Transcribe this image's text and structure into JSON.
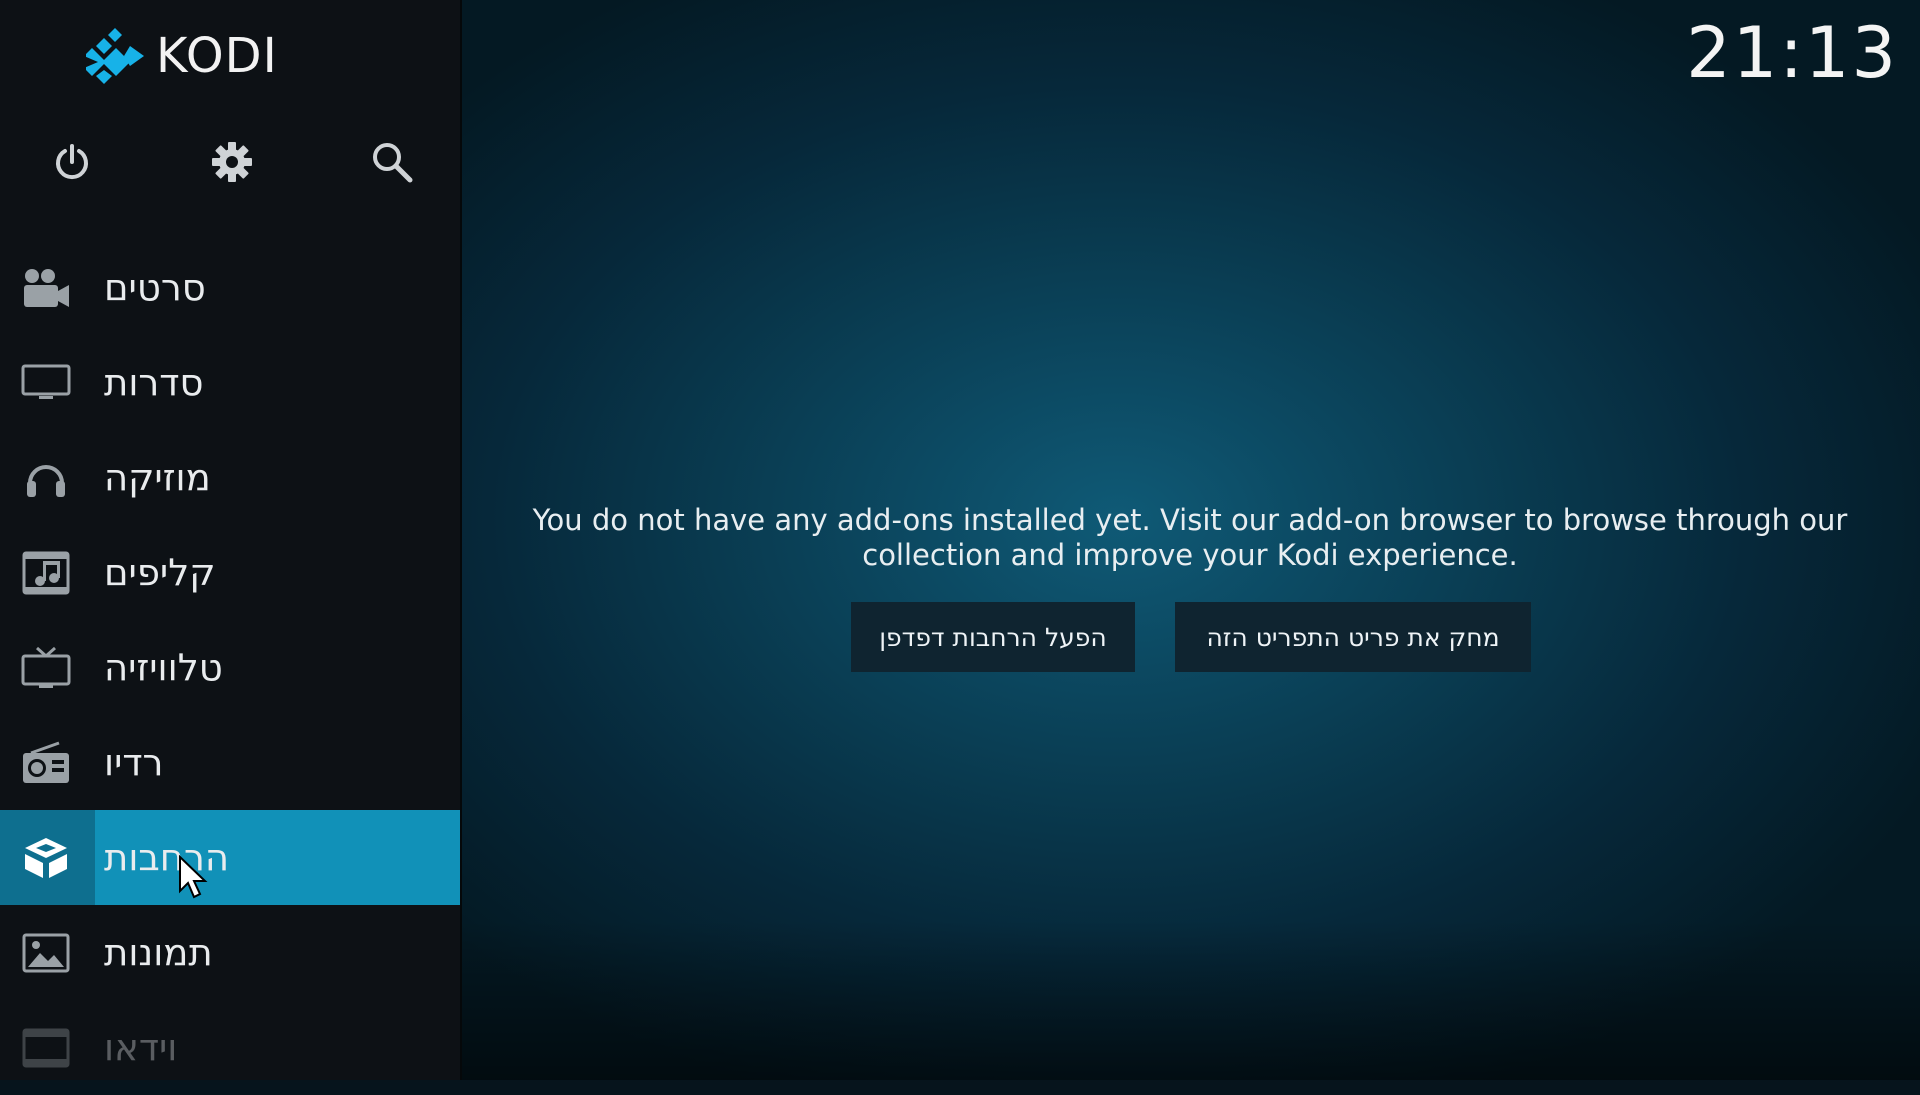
{
  "app": {
    "logo_text": "KODI",
    "clock": "21:13"
  },
  "top_icons": [
    {
      "name": "power-icon"
    },
    {
      "name": "gear-icon"
    },
    {
      "name": "search-icon"
    }
  ],
  "sidebar": {
    "items": [
      {
        "label": "סרטים",
        "icon": "movies-icon"
      },
      {
        "label": "סדרות",
        "icon": "tv-shows-icon"
      },
      {
        "label": "מוזיקה",
        "icon": "headphones-icon"
      },
      {
        "label": "קליפים",
        "icon": "music-video-icon"
      },
      {
        "label": "טלוויזיה",
        "icon": "live-tv-icon"
      },
      {
        "label": "רדיו",
        "icon": "radio-icon"
      },
      {
        "label": "הרחבות",
        "icon": "addons-box-icon",
        "active": true
      },
      {
        "label": "תמונות",
        "icon": "pictures-icon"
      },
      {
        "label": "וידאו",
        "icon": "video-film-icon",
        "faded": true
      }
    ]
  },
  "main": {
    "message": "You do not have any add-ons installed yet. Visit our add-on browser to browse through our collection and improve your Kodi experience.",
    "buttons": {
      "browser": "הפעל הרחבות דפדפן",
      "remove": "מחק את פריט התפריט הזה"
    }
  },
  "colors": {
    "accent": "#1191b8",
    "accent_dark": "#0e6f8f",
    "sidebar_bg": "#0d1115",
    "button_bg": "#0f2430",
    "kodi_logo": "#17b2e8"
  }
}
